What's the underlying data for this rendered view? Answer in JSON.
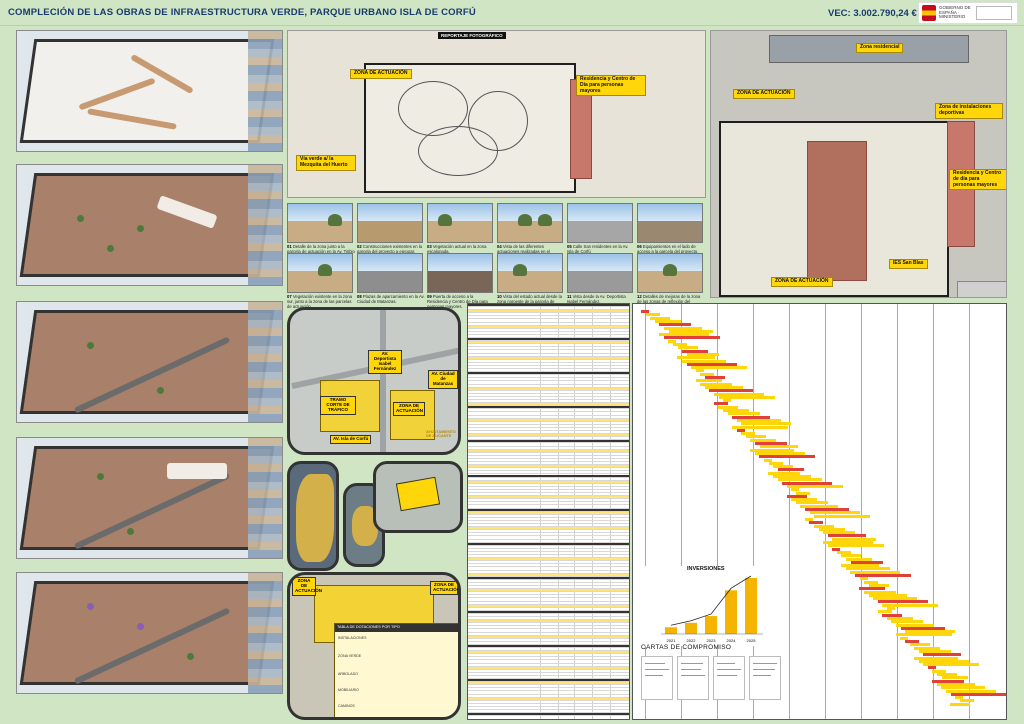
{
  "header": {
    "title": "COMPLECIÓN DE LAS OBRAS DE INFRAESTRUCTURA VERDE, PARQUE URBANO ISLA DE CORFÚ",
    "vec": "VEC: 3.002.790,24 €"
  },
  "center": {
    "report_title": "REPORTAJE FOTOGRÁFICO",
    "aerial_labels": {
      "zona_actuacion": "ZONA DE ACTUACIÓN",
      "residencia": "Residencia y Centro de Día para personas mayores",
      "cauce": "Vía verde a/ la Mezquita del Huerto"
    },
    "photos": [
      {
        "num": "01",
        "caption": "Detalle de la zona junto a la parcela de actuación en la Av. Tiribio Pascuerte y Calle"
      },
      {
        "num": "02",
        "caption": "Construcciones existentes en la parcela del proyecto a ejecutar."
      },
      {
        "num": "03",
        "caption": "Vegetación actual en la zona escalonada."
      },
      {
        "num": "04",
        "caption": "Vista de las diferentes actuaciones realizadas en el parque."
      },
      {
        "num": "05",
        "caption": "Calle San residentes en la Av. Isla de Corfú"
      },
      {
        "num": "06",
        "caption": "Equipamientos en el lado de acceso a la parcela del proyecto."
      },
      {
        "num": "07",
        "caption": "Vegetación existente en la zona sur, junto a la zona de las parcelas de actuación."
      },
      {
        "num": "08",
        "caption": "Plazas de aparcamiento en la Av. Ciudad de Matanzas."
      },
      {
        "num": "09",
        "caption": "Puerta de acceso a la Residencia y Centro de Día para personas mayores."
      },
      {
        "num": "10",
        "caption": "Vista del estado actual desde la zona noroeste de la parcela de actuación."
      },
      {
        "num": "11",
        "caption": "Vista desde la Av. Deportista Isabel Fernández."
      },
      {
        "num": "12",
        "caption": "Detalles de mejoras de la zona de las zonas de reflexión del parque."
      }
    ],
    "map_labels": {
      "zona_actuacion": "ZONA DE ACTUACIÓN",
      "tramo_corte": "TRAMO CORTE DE TRÁFICO",
      "av_isla_corfu": "AV. Isla de Corfú",
      "av_ciudad_matanzas": "AV. Ciudad de Matanzas",
      "av_deportista": "AV. Deportista Isabel Fernández",
      "municipality": "AYUNTAMIENTO DE ALICANTE"
    },
    "zone_map_labels": {
      "zona_actuacion": "ZONA DE ACTUACIÓN",
      "zona_actuacion_2": "ZONA DE ACTUACIÓN"
    },
    "legend_table": {
      "header": "TABLA DE DOTACIONES POR TIPO",
      "rows": [
        "INSTALACIONES",
        "ZONA VERDE",
        "ARBOLADO",
        "MOBILIARIO",
        "CAMINOS"
      ]
    }
  },
  "right": {
    "labels": {
      "zona_residencial": "Zona residencial",
      "zona_actuacion": "ZONA DE ACTUACIÓN",
      "zona_instalaciones": "Zona de instalaciones deportivas",
      "residencia": "Residencia y Centro de día para personas mayores",
      "ies": "IES San Blas",
      "zona_actuacion_2": "ZONA DE ACTUACIÓN"
    },
    "investment_title": "INVERSIONES",
    "investment_years": [
      "2021",
      "2022",
      "2023",
      "2024",
      "2025"
    ],
    "investment_values": [
      0.12,
      0.2,
      0.32,
      0.78,
      1.0
    ],
    "cartas_title": "CARTAS DE COMPROMISO",
    "colors": {
      "accent": "#ffd60a",
      "red": "#e0403a",
      "green": "#cfe5c4",
      "title": "#1a3a6e"
    }
  }
}
